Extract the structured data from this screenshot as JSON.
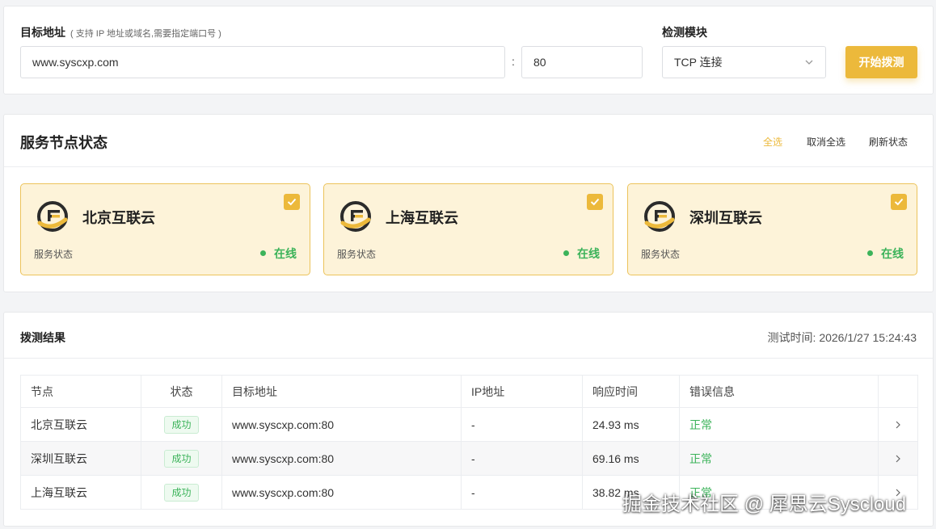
{
  "form": {
    "target_label": "目标地址",
    "target_hint": "( 支持 IP 地址或域名,需要指定端口号 )",
    "target_value": "www.syscxp.com",
    "colon": ":",
    "port_value": "80",
    "module_label": "检测模块",
    "module_value": "TCP 连接",
    "start_label": "开始拨测",
    "accent_color": "#ecb93b"
  },
  "nodes": {
    "title": "服务节点状态",
    "select_all": "全选",
    "deselect_all": "取消全选",
    "refresh": "刷新状态",
    "items": [
      {
        "name": "北京互联云",
        "status_label": "服务状态",
        "status": "在线",
        "checked": true
      },
      {
        "name": "上海互联云",
        "status_label": "服务状态",
        "status": "在线",
        "checked": true
      },
      {
        "name": "深圳互联云",
        "status_label": "服务状态",
        "status": "在线",
        "checked": true
      }
    ]
  },
  "results": {
    "title": "拨测结果",
    "test_time": "测试时间: 2026/1/27 15:24:43",
    "columns": [
      "节点",
      "状态",
      "目标地址",
      "IP地址",
      "响应时间",
      "错误信息"
    ],
    "rows": [
      {
        "node": "北京互联云",
        "status": "成功",
        "target": "www.syscxp.com:80",
        "ip": "-",
        "time": "24.93 ms",
        "error": "正常"
      },
      {
        "node": "深圳互联云",
        "status": "成功",
        "target": "www.syscxp.com:80",
        "ip": "-",
        "time": "69.16 ms",
        "error": "正常"
      },
      {
        "node": "上海互联云",
        "status": "成功",
        "target": "www.syscxp.com:80",
        "ip": "-",
        "time": "38.82 ms",
        "error": "正常"
      }
    ]
  },
  "watermark": "掘金技术社区 @ 犀思云Syscloud"
}
